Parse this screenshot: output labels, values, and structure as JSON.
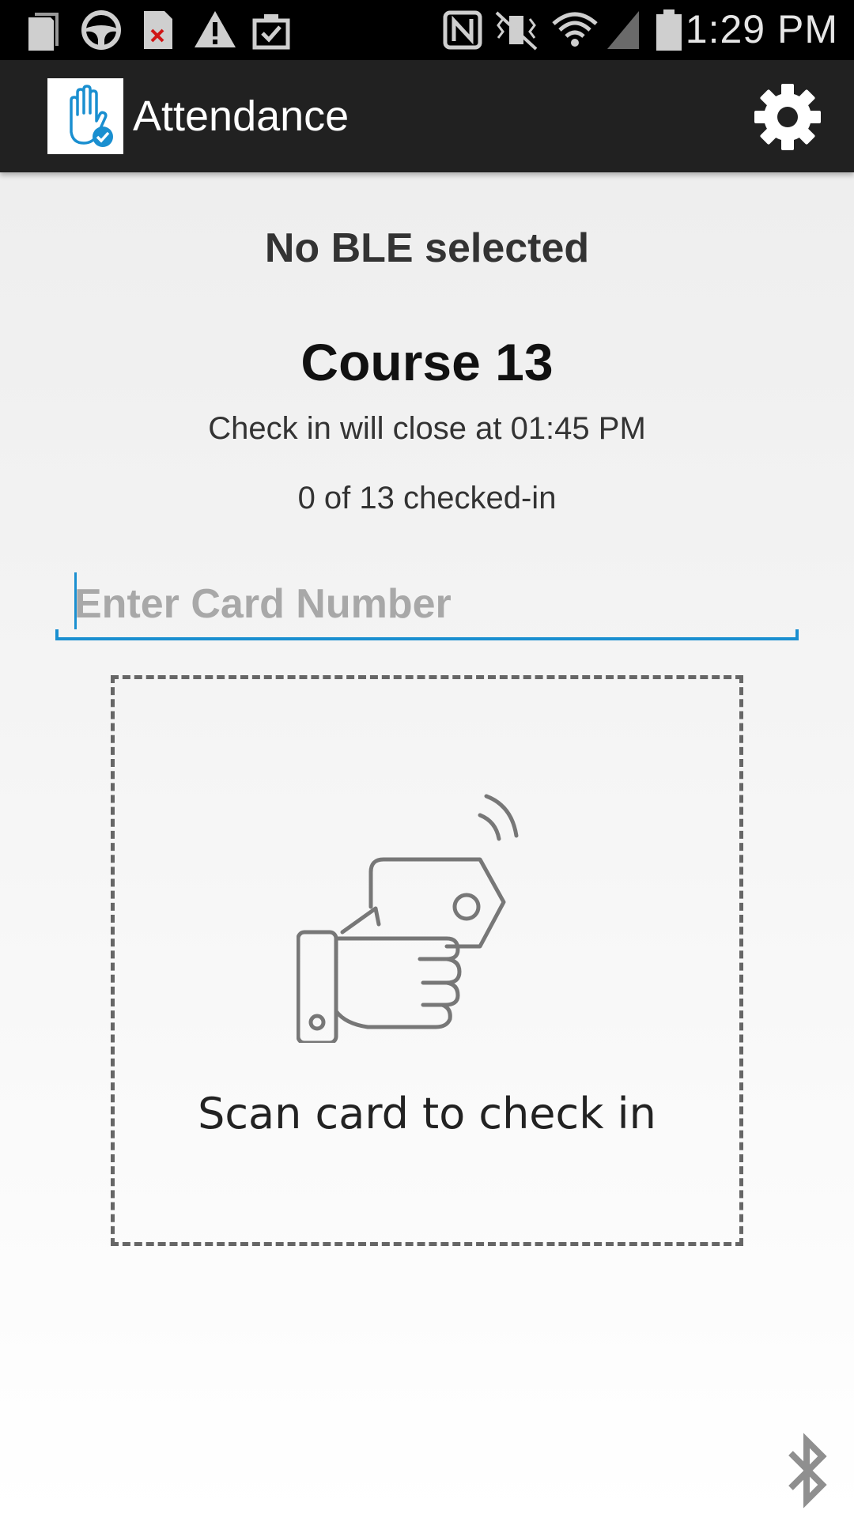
{
  "status_bar": {
    "time": "1:29 PM",
    "icons": [
      "sim-card-icon",
      "steering-wheel-icon",
      "file-error-icon",
      "warning-icon",
      "clipboard-check-icon",
      "nfc-icon",
      "vibrate-icon",
      "wifi-icon",
      "signal-icon",
      "battery-icon"
    ]
  },
  "action_bar": {
    "title": "Attendance",
    "logo_icon": "raised-hand-check-icon",
    "settings_icon": "gear-icon"
  },
  "main": {
    "ble_status": "No BLE selected",
    "course_title": "Course 13",
    "close_time": "Check in will close at 01:45 PM",
    "checkin_count": "0 of 13 checked-in",
    "card_input": {
      "placeholder": "Enter Card Number",
      "value": ""
    },
    "scan": {
      "icon": "hand-holding-card-icon",
      "label": "Scan card to check in"
    }
  },
  "footer": {
    "bluetooth_icon": "bluetooth-icon"
  },
  "colors": {
    "accent": "#1a8fd0",
    "action_bar": "#212121",
    "status_bar": "#000000"
  }
}
